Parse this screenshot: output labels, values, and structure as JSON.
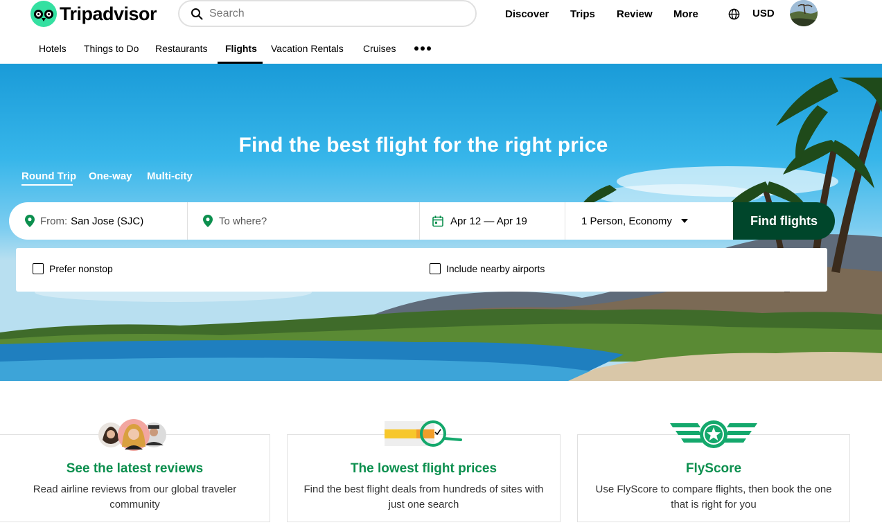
{
  "header": {
    "logo_text": "Tripadvisor",
    "search_placeholder": "Search",
    "nav": [
      "Discover",
      "Trips",
      "Review",
      "More"
    ],
    "currency": "USD"
  },
  "subnav": {
    "items": [
      "Hotels",
      "Things to Do",
      "Restaurants",
      "Flights",
      "Vacation Rentals",
      "Cruises"
    ],
    "active": "Flights"
  },
  "hero": {
    "title": "Find the best flight for the right price",
    "trip_tabs": [
      "Round Trip",
      "One-way",
      "Multi-city"
    ],
    "active_tab": "Round Trip",
    "from_label": "From:",
    "from_value": "San Jose (SJC)",
    "to_placeholder": "To where?",
    "dates": "Apr 12 — Apr 19",
    "travelers": "1 Person, Economy",
    "find_button": "Find flights",
    "options": [
      "Prefer nonstop",
      "Include nearby airports"
    ]
  },
  "features": [
    {
      "title": "See the latest reviews",
      "text": "Read airline reviews from our global traveler community",
      "icon": "reviewers-avatars-icon"
    },
    {
      "title": "The lowest flight prices",
      "text": "Find the best flight deals from hundreds of sites with just one search",
      "icon": "price-search-icon"
    },
    {
      "title": "FlyScore",
      "text": "Use FlyScore to compare flights, then book the one that is right for you",
      "icon": "flyscore-wings-icon"
    }
  ],
  "colors": {
    "brand_green": "#34e0a1",
    "dark_green": "#00462b",
    "feature_green": "#0c8f4e"
  }
}
